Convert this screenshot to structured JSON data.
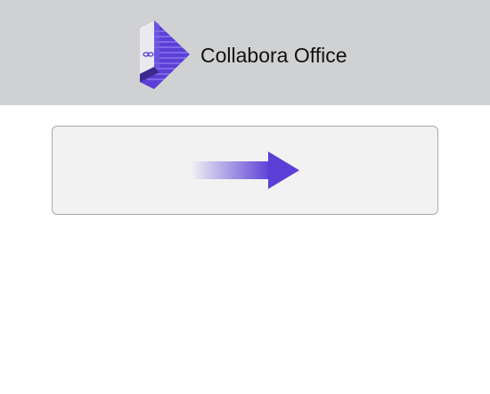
{
  "header": {
    "app_name": "Collabora Office",
    "logo_icon": "collabora-logo-icon",
    "background": "#d0d1d2"
  },
  "main": {
    "panel_icon": "arrow-right-icon",
    "accent": "#5b3fd6"
  }
}
